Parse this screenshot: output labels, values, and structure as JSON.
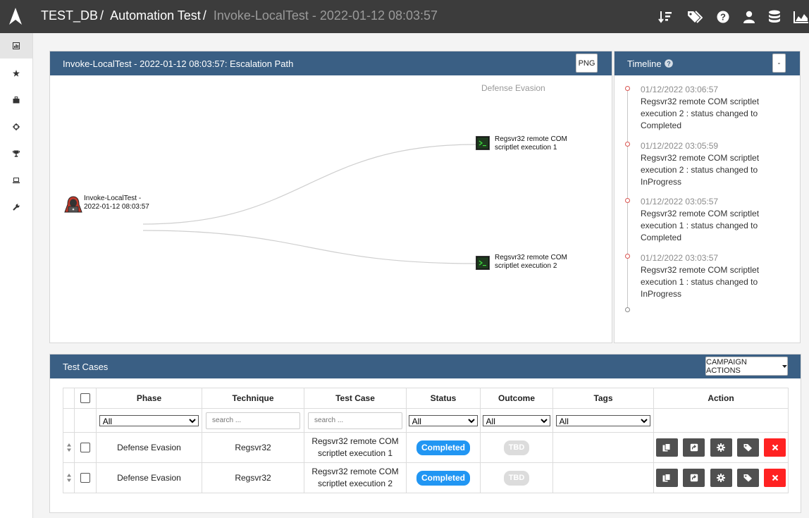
{
  "breadcrumb": {
    "db": "TEST_DB",
    "campaign": "Automation Test",
    "assessment": "Invoke-LocalTest - 2022-01-12 08:03:57"
  },
  "topbar_icons": [
    "sort-icon",
    "tags-icon",
    "help-icon",
    "user-icon",
    "database-icon",
    "chart-icon"
  ],
  "sidebar": {
    "items": [
      {
        "name": "dashboard-icon"
      },
      {
        "name": "star-icon"
      },
      {
        "name": "briefcase-icon"
      },
      {
        "name": "crosshair-icon"
      },
      {
        "name": "trophy-icon"
      },
      {
        "name": "laptop-icon"
      },
      {
        "name": "wrench-icon"
      }
    ]
  },
  "escalation": {
    "title": "Invoke-LocalTest - 2022-01-12 08:03:57: Escalation Path",
    "png_button": "PNG",
    "phase": "Defense Evasion",
    "root_line1": "Invoke-LocalTest -",
    "root_line2": "2022-01-12 08:03:57",
    "node1_line1": "Regsvr32 remote COM",
    "node1_line2": "scriptlet execution 1",
    "node2_line1": "Regsvr32 remote COM",
    "node2_line2": "scriptlet execution 2"
  },
  "timeline": {
    "title": "Timeline",
    "collapse_label": "-",
    "entries": [
      {
        "time": "01/12/2022 03:06:57",
        "text": "Regsvr32 remote COM scriptlet execution 2 : status changed to Completed"
      },
      {
        "time": "01/12/2022 03:05:59",
        "text": "Regsvr32 remote COM scriptlet execution 2 : status changed to InProgress"
      },
      {
        "time": "01/12/2022 03:05:57",
        "text": "Regsvr32 remote COM scriptlet execution 1 : status changed to Completed"
      },
      {
        "time": "01/12/2022 03:03:57",
        "text": "Regsvr32 remote COM scriptlet execution 1 : status changed to InProgress"
      }
    ]
  },
  "testcases": {
    "title": "Test Cases",
    "campaign_actions": "CAMPAIGN ACTIONS",
    "columns": [
      "Phase",
      "Technique",
      "Test Case",
      "Status",
      "Outcome",
      "Tags",
      "Action"
    ],
    "filter_all": "All",
    "search_placeholder": "search ...",
    "rows": [
      {
        "phase": "Defense Evasion",
        "technique": "Regsvr32",
        "testcase": "Regsvr32 remote COM scriptlet execution 1",
        "status": "Completed",
        "outcome": "TBD",
        "tags": ""
      },
      {
        "phase": "Defense Evasion",
        "technique": "Regsvr32",
        "testcase": "Regsvr32 remote COM scriptlet execution 2",
        "status": "Completed",
        "outcome": "TBD",
        "tags": ""
      }
    ]
  },
  "colors": {
    "topbar": "#3c3c3c",
    "panel_header": "#3a5f84",
    "status_completed": "#2196f3",
    "delete_button": "#ff2222"
  }
}
